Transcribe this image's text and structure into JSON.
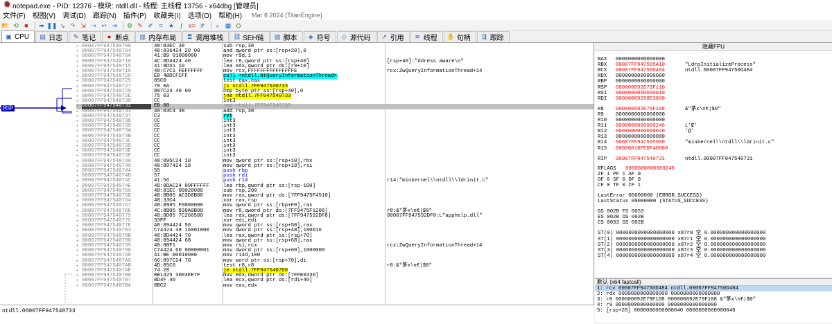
{
  "window": {
    "title": "notepad.exe - PID: 12376 - 模块: ntdll.dll - 线程: 主线程 13756 - x64dbg [管理员]"
  },
  "menu": {
    "items": [
      "文件(F)",
      "视图(V)",
      "调试(D)",
      "跟踪(N)",
      "插件(P)",
      "收藏夹(I)",
      "选项(O)",
      "帮助(H)"
    ],
    "build": "Mar 8 2024 (TitanEngine)"
  },
  "toolbar": {
    "icons": [
      "open-icon",
      "restart-icon",
      "close-icon",
      "run-icon",
      "pause-icon",
      "step-into-icon",
      "step-over-icon",
      "trace-into-icon",
      "trace-over-icon",
      "execute-till-return-icon",
      "run-to-user-icon",
      "scylla-icon",
      "patch-icon",
      "comments-icon",
      "labels-icon",
      "bookmarks-icon",
      "functions-icon",
      "expression-icon",
      "hash-icon",
      "find-icon",
      "calculator-icon",
      "settings-icon"
    ]
  },
  "tabs": [
    {
      "label": "CPU",
      "icon": "cpu-icon",
      "active": true
    },
    {
      "label": "日志",
      "icon": "log-icon"
    },
    {
      "label": "笔记",
      "icon": "notes-icon"
    },
    {
      "label": "断点",
      "icon": "breakpoint-icon"
    },
    {
      "label": "内存布局",
      "icon": "memory-icon"
    },
    {
      "label": "调用堆栈",
      "icon": "callstack-icon"
    },
    {
      "label": "SEH链",
      "icon": "seh-icon"
    },
    {
      "label": "脚本",
      "icon": "script-icon"
    },
    {
      "label": "符号",
      "icon": "symbols-icon"
    },
    {
      "label": "源代码",
      "icon": "source-icon"
    },
    {
      "label": "引用",
      "icon": "references-icon"
    },
    {
      "label": "线程",
      "icon": "threads-icon"
    },
    {
      "label": "句柄",
      "icon": "handles-icon"
    },
    {
      "label": "跟踪",
      "icon": "trace-icon"
    }
  ],
  "rip_label": "RIP",
  "disasm": [
    {
      "addr": "00007FF947540700",
      "bytes": "48:83EC 38",
      "instr": "sub rsp,38",
      "comment": ""
    },
    {
      "addr": "00007FF947540704",
      "bytes": "48:836424 20 00",
      "instr": "and qword ptr ss:[rsp+20],0",
      "comment": ""
    },
    {
      "addr": "00007FF94754070A",
      "bytes": "41:B9 01000000",
      "instr": "mov r9d,1",
      "comment": ""
    },
    {
      "addr": "00007FF947540710",
      "bytes": "4C:8D4424 40",
      "instr": "lea r8,qword ptr ss:[rsp+40]",
      "comment": "[rsp+40]:\"ddress aware\\n\""
    },
    {
      "addr": "00007FF947540715",
      "bytes": "41:8D51 10",
      "instr": "lea edx,qword ptr ds:[r9+10]",
      "comment": ""
    },
    {
      "addr": "00007FF947540719",
      "bytes": "48:C7C1 FEFFFFFF",
      "instr": "mov rcx,FFFFFFFFFFFFFFFE",
      "comment": "rcx:ZwQueryInformationThread+14"
    },
    {
      "addr": "00007FF947540720",
      "bytes": "E8 4BDCFCFF",
      "instr": "call <ntdll.NtQueryInformationThread>",
      "comment": "",
      "kind": "call"
    },
    {
      "addr": "00007FF947540725",
      "bytes": "85C0",
      "instr": "test eax,eax",
      "comment": ""
    },
    {
      "addr": "00007FF947540727",
      "bytes": "78 0A",
      "instr": "js ntdll.7FF947540733",
      "comment": "",
      "kind": "jmp"
    },
    {
      "addr": "00007FF947540729",
      "bytes": "807C24 40 00",
      "instr": "cmp byte ptr ss:[rsp+40],0",
      "comment": ""
    },
    {
      "addr": "00007FF94754072E",
      "bytes": "75 03",
      "instr": "jne ntdll.7FF947540733",
      "comment": "",
      "kind": "jmp"
    },
    {
      "addr": "00007FF947540730",
      "bytes": "CC",
      "instr": "int3",
      "comment": ""
    },
    {
      "addr": "00007FF947540731",
      "bytes": "EB 00",
      "instr": "jmp ntdll.7FF947540733",
      "comment": "",
      "kind": "cur"
    },
    {
      "addr": "00007FF947540733",
      "bytes": "48:83C4 38",
      "instr": "add rsp,38",
      "comment": ""
    },
    {
      "addr": "00007FF947540737",
      "bytes": "C3",
      "instr": "ret",
      "comment": "",
      "kind": "ret"
    },
    {
      "addr": "00007FF947540738",
      "bytes": "CC",
      "instr": "int3",
      "comment": ""
    },
    {
      "addr": "00007FF947540739",
      "bytes": "CC",
      "instr": "int3",
      "comment": ""
    },
    {
      "addr": "00007FF94754073A",
      "bytes": "CC",
      "instr": "int3",
      "comment": ""
    },
    {
      "addr": "00007FF94754073B",
      "bytes": "CC",
      "instr": "int3",
      "comment": ""
    },
    {
      "addr": "00007FF94754073C",
      "bytes": "CC",
      "instr": "int3",
      "comment": ""
    },
    {
      "addr": "00007FF94754073D",
      "bytes": "CC",
      "instr": "int3",
      "comment": ""
    },
    {
      "addr": "00007FF94754073E",
      "bytes": "CC",
      "instr": "int3",
      "comment": ""
    },
    {
      "addr": "00007FF94754073F",
      "bytes": "CC",
      "instr": "int3",
      "comment": ""
    },
    {
      "addr": "00007FF947540740",
      "bytes": "48:895C24 10",
      "instr": "mov qword ptr ss:[rsp+10],rbx",
      "comment": ""
    },
    {
      "addr": "00007FF947540745",
      "bytes": "48:897424 18",
      "instr": "mov qword ptr ss:[rsp+18],rsi",
      "comment": ""
    },
    {
      "addr": "00007FF94754074A",
      "bytes": "55",
      "instr": "push rbp",
      "comment": "",
      "kind": "push"
    },
    {
      "addr": "00007FF94754074B",
      "bytes": "57",
      "instr": "push rdi",
      "comment": "",
      "kind": "push"
    },
    {
      "addr": "00007FF94754074C",
      "bytes": "41:56",
      "instr": "push r14",
      "comment": "r14:\"minkernel\\\\ntdll\\\\ldrinit.c\"",
      "kind": "push"
    },
    {
      "addr": "00007FF94754074E",
      "bytes": "48:8DAC24 00FFFFFF",
      "instr": "lea rbp,qword ptr ss:[rsp-100]",
      "comment": ""
    },
    {
      "addr": "00007FF947540756",
      "bytes": "48:81EC 00020000",
      "instr": "sub rsp,200",
      "comment": ""
    },
    {
      "addr": "00007FF94754075D",
      "bytes": "48:8B05 AC3D0B00",
      "instr": "mov rax,qword ptr ds:[7FF9475F4510]",
      "comment": ""
    },
    {
      "addr": "00007FF947540764",
      "bytes": "48:33C4",
      "instr": "xor rax,rsp",
      "comment": ""
    },
    {
      "addr": "00007FF947540767",
      "bytes": "48:8985 F0000000",
      "instr": "mov qword ptr ss:[rbp+F0],rax",
      "comment": ""
    },
    {
      "addr": "00007FF94754076E",
      "bytes": "4C:8B05 930A0B00",
      "instr": "mov r8,qword ptr ds:[7FF9475F1208]",
      "comment": "r8:&\"茅x\\n€|$0\""
    },
    {
      "addr": "00007FF947540775",
      "bytes": "48:8D05 7C260500",
      "instr": "lea rax,qword ptr ds:[7FF947592DF8]",
      "comment": "00007FF947592DF8:L\"apphelp.dll\""
    },
    {
      "addr": "00007FF94754077C",
      "bytes": "33FF",
      "instr": "xor edi,edi",
      "comment": ""
    },
    {
      "addr": "00007FF94754077E",
      "bytes": "48:894424 50",
      "instr": "mov qword ptr ss:[rsp+50],rax",
      "comment": ""
    },
    {
      "addr": "00007FF947540783",
      "bytes": "C74424 48 16001800",
      "instr": "mov dword ptr ss:[rsp+48],180016",
      "comment": ""
    },
    {
      "addr": "00007FF94754078B",
      "bytes": "48:8D4424 70",
      "instr": "lea rax,qword ptr ss:[rsp+70]",
      "comment": ""
    },
    {
      "addr": "00007FF947540790",
      "bytes": "48:894424 68",
      "instr": "mov qword ptr ss:[rsp+68],rax",
      "comment": ""
    },
    {
      "addr": "00007FF947540795",
      "bytes": "48:8BF1",
      "instr": "mov rsi,rcx",
      "comment": "rcx:ZwQueryInformationThread+14"
    },
    {
      "addr": "00007FF947540798",
      "bytes": "C74424 60 00000001",
      "instr": "mov dword ptr ss:[rsp+60],1000000",
      "comment": ""
    },
    {
      "addr": "00007FF9475407A0",
      "bytes": "41:BE 00010000",
      "instr": "mov r14d,100",
      "comment": ""
    },
    {
      "addr": "00007FF9475407A6",
      "bytes": "66:897C24 70",
      "instr": "mov word ptr ss:[rsp+70],di",
      "comment": ""
    },
    {
      "addr": "00007FF9475407AB",
      "bytes": "4D:85C0",
      "instr": "test r8,r8",
      "comment": "r8:&\"茅x\\n€|$0\""
    },
    {
      "addr": "00007FF9475407AE",
      "bytes": "74 28",
      "instr": "je ntdll.7FF9475407D8",
      "comment": "",
      "kind": "jmp"
    },
    {
      "addr": "00007FF9475407B0",
      "bytes": "8B1425 3003FE7F",
      "instr": "mov edx,dword ptr ds:[7FFE0330]",
      "comment": ""
    },
    {
      "addr": "00007FF9475407B7",
      "bytes": "8D4F 40",
      "instr": "lea ecx,qword ptr ds:[rdi+40]",
      "comment": ""
    },
    {
      "addr": "00007FF9475407BA",
      "bytes": "8BC2",
      "instr": "mov eax,edx",
      "comment": ""
    }
  ],
  "registers": {
    "header": "隐藏FPU",
    "gp": [
      {
        "name": "RAX",
        "value": "0000000000000000",
        "comment": ""
      },
      {
        "name": "RBX",
        "value": "00007FF947595A10",
        "comment": "\"LdrpInitializeProcess\"",
        "changed": true
      },
      {
        "name": "RCX",
        "value": "00007FF94750D484",
        "comment": "ntdll.00007FF94750D484",
        "changed": true
      },
      {
        "name": "RDX",
        "value": "0000000000000000",
        "comment": ""
      },
      {
        "name": "RBP",
        "value": "0000000000000000",
        "comment": ""
      },
      {
        "name": "RSP",
        "value": "000000892E79F110",
        "comment": "",
        "changed": true
      },
      {
        "name": "RSI",
        "value": "0000000000000010",
        "comment": "",
        "changed": true
      },
      {
        "name": "RDI",
        "value": "00000089288E3000",
        "comment": "",
        "changed": true
      },
      {
        "name": "R8",
        "value": "000000892E79F108",
        "comment": "&\"茅x\\n€|$0\"",
        "changed": true
      },
      {
        "name": "R9",
        "value": "0000000000000000",
        "comment": ""
      },
      {
        "name": "R10",
        "value": "0000000000000000",
        "comment": ""
      },
      {
        "name": "R11",
        "value": "0000000000000246",
        "comment": "L'Ɇ'",
        "changed": true
      },
      {
        "name": "R12",
        "value": "0000000000000040",
        "comment": "'@'",
        "changed": true
      },
      {
        "name": "R13",
        "value": "0000000000000000",
        "comment": ""
      },
      {
        "name": "R14",
        "value": "00007FF947595900",
        "comment": "\"minkernel\\\\ntdll\\\\ldrinit.c\"",
        "changed": true
      },
      {
        "name": "R15",
        "value": "00000018FEDF40000",
        "comment": "",
        "changed": true
      }
    ],
    "rip": {
      "name": "RIP",
      "value": "00007FF947540731",
      "comment": "ntdll.00007FF947540731"
    },
    "rflags": {
      "name": "RFLAGS",
      "value": "0000000000000246"
    },
    "flags_lines": [
      "ZF 1  PF 1  AF 0",
      "OF 0  SF 0  DF 0",
      "CF 0  TF 0  IF 1"
    ],
    "last_error": "LastError  00000000 (ERROR_SUCCESS)",
    "last_status": "LastStatus 00000000 (STATUS_SUCCESS)",
    "seg_lines": [
      "GS 002B  FS 0053",
      "ES 002B  DS 002B",
      "CS 0033  SS 002B"
    ],
    "fpu_lines": [
      "ST(0) 0000000000000000000 x87r0 空 0.000000000000000000",
      "ST(1) 0000000000000000000 x87r1 空 0.000000000000000000",
      "ST(2) 0000000000000000000 x87r2 空 0.000000000000000000",
      "ST(3) 0000000000000000000 x87r3 空 0.000000000000000000",
      "ST(4) 0000000000000000000 x87r4 空 0.000000000000000000"
    ]
  },
  "callconv": {
    "header": "默认 (x64 fastcall)",
    "lines": [
      "1: rcx 00007FF94750D484 ntdll.00007FF94750D484",
      "2: rdx 0000000000000000 0000000000000000",
      "3: r8 000000892E79F108 000000892E79F108 &\"茅x\\n€|$0\"",
      "4: r9 0000000000000000 0000000000000000",
      "5: [rsp+28] 0000000000000040 0000000000000040"
    ]
  },
  "status": {
    "text": "ntdll.00007FF947540733"
  }
}
